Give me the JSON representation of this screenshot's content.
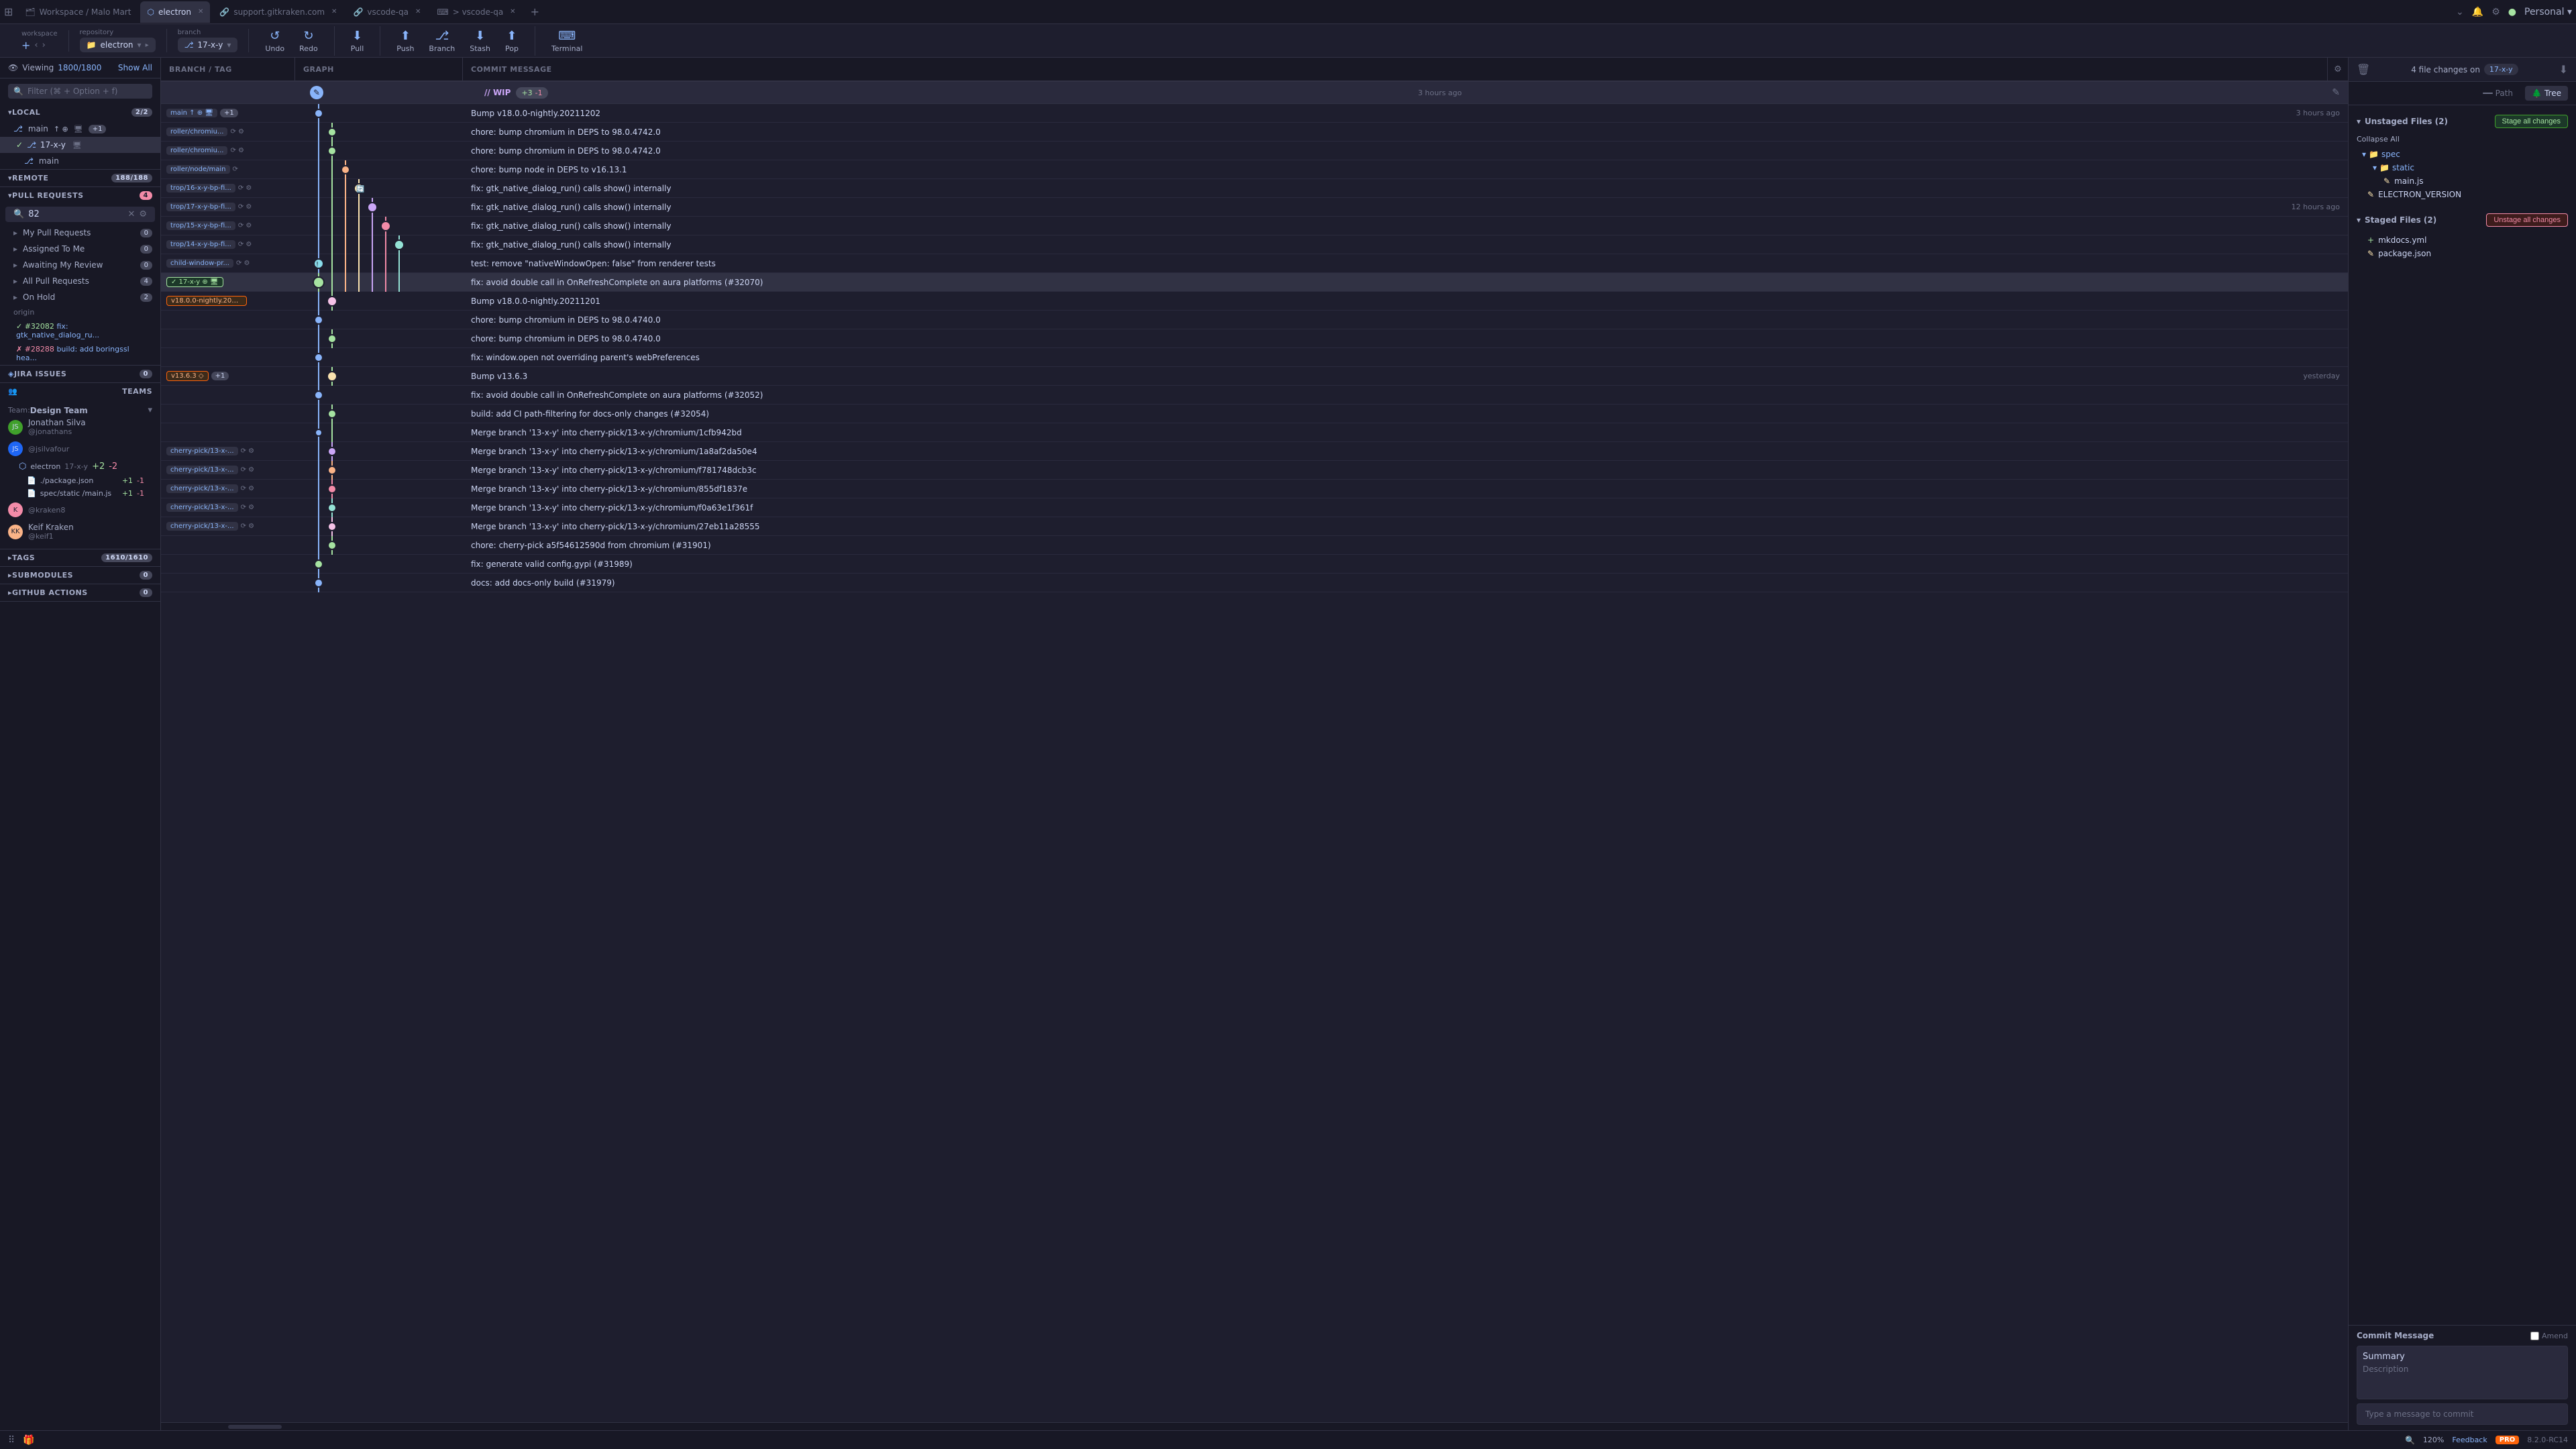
{
  "window": {
    "icon": "🖥"
  },
  "tabs": [
    {
      "id": "workspace",
      "label": "Workspace / Malo Mart",
      "type": "workspace",
      "active": false,
      "closable": false
    },
    {
      "id": "electron",
      "label": "electron",
      "type": "repo",
      "active": true,
      "closable": true
    },
    {
      "id": "support",
      "label": "support.gitkraken.com",
      "type": "browser",
      "active": false,
      "closable": true
    },
    {
      "id": "vscode-qa",
      "label": "vscode-qa",
      "type": "browser",
      "active": false,
      "closable": true
    },
    {
      "id": "vscode-qa2",
      "label": "> vscode-qa",
      "type": "terminal",
      "active": false,
      "closable": true
    }
  ],
  "toolbar": {
    "workspace_label": "workspace",
    "repository_label": "repository",
    "branch_label": "branch",
    "undo_label": "Undo",
    "redo_label": "Redo",
    "pull_label": "Pull",
    "push_label": "Push",
    "branch_btn_label": "Branch",
    "stash_label": "Stash",
    "pop_label": "Pop",
    "terminal_label": "Terminal",
    "current_repo": "electron",
    "current_branch": "17-x-y"
  },
  "sidebar": {
    "viewing": "1800",
    "total": "1800",
    "show_all": "Show All",
    "filter_placeholder": "Filter (⌘ + Option + f)",
    "local_label": "LOCAL",
    "local_count": "2/2",
    "branches": [
      {
        "name": "main",
        "active": false,
        "remote": true
      },
      {
        "name": "17-x-y",
        "active": true,
        "remote": false
      },
      {
        "name": "main",
        "indent": true,
        "active": false
      }
    ],
    "remote_label": "REMOTE",
    "remote_count": "188/188",
    "pull_requests_label": "PULL REQUESTS",
    "pull_requests_count": "4",
    "pr_search": "82",
    "pr_categories": [
      {
        "label": "My Pull Requests",
        "count": "0"
      },
      {
        "label": "Assigned To Me",
        "count": "0"
      },
      {
        "label": "Awaiting My Review",
        "count": "0"
      },
      {
        "label": "All Pull Requests",
        "count": "4"
      },
      {
        "label": "On Hold",
        "count": "2"
      }
    ],
    "origin_label": "origin",
    "pr_items": [
      {
        "number": "#32082",
        "title": "fix: gtk_native_dialog_ru...",
        "color": "green"
      },
      {
        "number": "#28288",
        "title": "build: add boringssl hea...",
        "color": "red"
      }
    ],
    "jira_label": "JIRA ISSUES",
    "jira_count": "0",
    "teams_label": "TEAMS",
    "team_name": "Design Team",
    "team_members": [
      {
        "name": "Jonathan Silva",
        "handle": "@jonathans",
        "color": "green"
      },
      {
        "name": "@jsilvafour",
        "handle": "",
        "color": "blue"
      }
    ],
    "commit_branch": "electron",
    "commit_branch2": "17-x-y",
    "commit_stat": "+2 -2",
    "files": [
      {
        "name": "./package.json",
        "added": "+1",
        "removed": "-1"
      },
      {
        "name": "spec/static /main.js",
        "added": "+1",
        "removed": "-1"
      }
    ],
    "kraken_handle": "@kraken8",
    "keif_name": "Keif Kraken",
    "keif_handle": "@keif1",
    "tags_label": "TAGS",
    "tags_count": "1610/1610",
    "submodules_label": "SUBMODULES",
    "submodules_count": "0",
    "github_actions_label": "GITHUB ACTIONS",
    "github_actions_count": "0"
  },
  "graph": {
    "column_branch": "BRANCH / TAG",
    "column_graph": "GRAPH",
    "column_message": "COMMIT MESSAGE",
    "wip_label": "// WIP",
    "wip_plus": "3",
    "wip_minus": "1",
    "wip_time": "3 hours ago",
    "commits": [
      {
        "branch": "main ↑ ⊕ 🖥 +1",
        "message": "Bump v18.0.0-nightly.20211202",
        "time": "3 hours ago",
        "color": "#89b4fa",
        "selected": false
      },
      {
        "branch": "roller/chromiu...",
        "message": "chore: bump chromium in DEPS to 98.0.4742.0",
        "color": "#a6e3a1",
        "selected": false
      },
      {
        "branch": "roller/chromiu...",
        "message": "chore: bump chromium in DEPS to 98.0.4742.0",
        "color": "#a6e3a1",
        "selected": false
      },
      {
        "branch": "roller/node/main",
        "message": "chore: bump node in DEPS to v16.13.1",
        "color": "#fab387",
        "selected": false
      },
      {
        "branch": "trop/16-x-y-bp-fi...",
        "message": "fix: gtk_native_dialog_run() calls show() internally",
        "color": "#f9e2af",
        "selected": false
      },
      {
        "branch": "trop/17-x-y-bp-fi...",
        "message": "fix: gtk_native_dialog_run() calls show() internally",
        "color": "#cba6f7",
        "selected": false,
        "time": "12 hours ago"
      },
      {
        "branch": "trop/15-x-y-bp-fi...",
        "message": "fix: gtk_native_dialog_run() calls show() internally",
        "color": "#f38ba8",
        "selected": false
      },
      {
        "branch": "trop/14-x-y-bp-fi...",
        "message": "fix: gtk_native_dialog_run() calls show() internally",
        "color": "#94e2d5",
        "selected": false
      },
      {
        "branch": "child-window-pr...",
        "message": "test: remove \"nativeWindowOpen: false\" from renderer tests",
        "color": "#89dceb",
        "selected": false
      },
      {
        "branch": "✓ 17-x-y ⊕ 🖥",
        "message": "fix: avoid double call in OnRefreshComplete on aura platforms (#32070)",
        "color": "#a6e3a1",
        "selected": true,
        "active": true
      },
      {
        "branch": "v18.0.0-nightly.202...",
        "message": "Bump v18.0.0-nightly.20211201",
        "color": "#f5c2e7",
        "selected": false
      },
      {
        "branch": "",
        "message": "chore: bump chromium in DEPS to 98.0.4740.0",
        "color": "#89b4fa",
        "selected": false
      },
      {
        "branch": "",
        "message": "chore: bump chromium in DEPS to 98.0.4740.0",
        "color": "#a6e3a1",
        "selected": false
      },
      {
        "branch": "",
        "message": "fix: window.open not overriding parent's webPreferences",
        "color": "#89b4fa",
        "selected": false
      },
      {
        "branch": "v13.6.3 ◇ +1",
        "message": "Bump v13.6.3",
        "color": "#f9e2af",
        "selected": false,
        "time": "yesterday"
      },
      {
        "branch": "",
        "message": "fix: avoid double call in OnRefreshComplete on aura platforms (#32052)",
        "color": "#89b4fa",
        "selected": false
      },
      {
        "branch": "",
        "message": "build: add CI path-filtering for docs-only changes (#32054)",
        "color": "#a6e3a1",
        "selected": false
      },
      {
        "branch": "",
        "message": "Merge branch '13-x-y' into cherry-pick/13-x-y/chromium/1cfb942bd",
        "color": "#89b4fa",
        "selected": false
      },
      {
        "branch": "cherry-pick/13-x-...",
        "message": "Merge branch '13-x-y' into cherry-pick/13-x-y/chromium/1a8af2da50e4",
        "color": "#cba6f7",
        "selected": false
      },
      {
        "branch": "cherry-pick/13-x-...",
        "message": "Merge branch '13-x-y' into cherry-pick/13-x-y/chromium/f781748dcb3c",
        "color": "#fab387",
        "selected": false
      },
      {
        "branch": "cherry-pick/13-x-...",
        "message": "Merge branch '13-x-y' into cherry-pick/13-x-y/chromium/855df1837e",
        "color": "#f38ba8",
        "selected": false
      },
      {
        "branch": "cherry-pick/13-x-...",
        "message": "Merge branch '13-x-y' into cherry-pick/13-x-y/chromium/f0a63e1f361f",
        "color": "#94e2d5",
        "selected": false
      },
      {
        "branch": "cherry-pick/13-x-...",
        "message": "Merge branch '13-x-y' into cherry-pick/13-x-y/chromium/27eb11a28555",
        "color": "#f5c2e7",
        "selected": false
      },
      {
        "branch": "",
        "message": "chore: cherry-pick a5f54612590d from chromium (#31901)",
        "color": "#89b4fa",
        "selected": false
      },
      {
        "branch": "",
        "message": "fix: generate valid config.gypi (#31989)",
        "color": "#a6e3a1",
        "selected": false
      },
      {
        "branch": "",
        "message": "docs: add docs-only build (#31979)",
        "color": "#89b4fa",
        "selected": false
      }
    ]
  },
  "right_panel": {
    "file_changes_label": "4 file changes on",
    "branch_name": "17-x-y",
    "tab_path": "Path",
    "tab_tree": "Tree",
    "tab_tree_active": true,
    "unstaged_section": "Unstaged Files (2)",
    "staged_section": "Staged Files (2)",
    "collapse_all": "Collapse All",
    "stage_btn": "Stage all changes",
    "unstage_btn": "Unstage all changes",
    "unstaged_files": {
      "folder": "spec",
      "subfolder": "static",
      "file1": "main.js",
      "file2": "ELECTRON_VERSION"
    },
    "staged_files": {
      "file1": "mkdocs.yml",
      "file2": "package.json"
    },
    "commit_message_title": "Commit Message",
    "amend_label": "Amend",
    "summary_placeholder": "Summary",
    "description_placeholder": "Description",
    "type_message_placeholder": "Type a message to commit"
  },
  "status_bar": {
    "graph_icon": "⠿",
    "gift_icon": "🎁",
    "zoom": "120%",
    "feedback": "Feedback",
    "pro_badge": "PRO",
    "version": "8.2.0-RC14"
  }
}
